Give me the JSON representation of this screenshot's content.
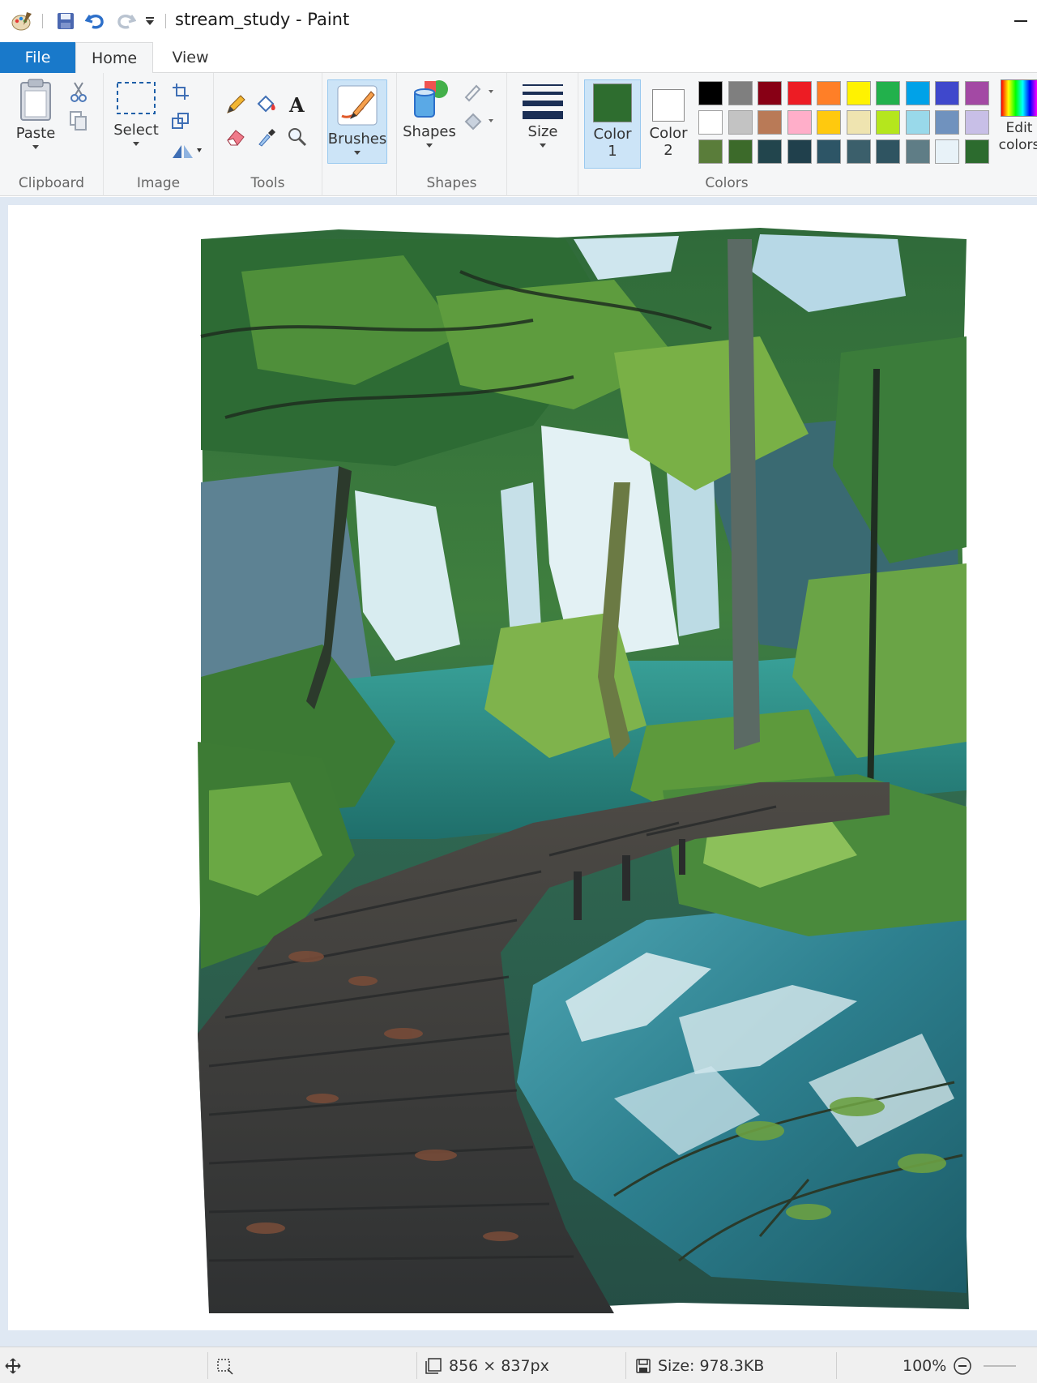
{
  "window": {
    "title": "stream_study - Paint"
  },
  "tabs": [
    {
      "label": "File"
    },
    {
      "label": "Home"
    },
    {
      "label": "View"
    }
  ],
  "ribbon": {
    "clipboard": {
      "group_label": "Clipboard",
      "paste_label": "Paste"
    },
    "image": {
      "group_label": "Image",
      "select_label": "Select"
    },
    "tools": {
      "group_label": "Tools"
    },
    "brushes": {
      "label": "Brushes"
    },
    "shapes": {
      "group_label": "Shapes",
      "shapes_label": "Shapes"
    },
    "size": {
      "label": "Size"
    },
    "colors": {
      "group_label": "Colors",
      "color1_line1": "Color",
      "color1_line2": "1",
      "color2_line1": "Color",
      "color2_line2": "2",
      "edit_line1": "Edit",
      "edit_line2": "colors",
      "color1_value": "#2e6d2f",
      "color2_value": "#ffffff",
      "palette": [
        "#000000",
        "#7f7f7f",
        "#880015",
        "#ed1c24",
        "#ff7f27",
        "#fff200",
        "#22b14c",
        "#00a2e8",
        "#3f48cc",
        "#a349a4",
        "#ffffff",
        "#c3c3c3",
        "#b97a57",
        "#ffaec9",
        "#ffc90e",
        "#efe4b0",
        "#b5e61d",
        "#99d9ea",
        "#7092be",
        "#c8bfe7",
        "#5a7d3a",
        "#3c6a2a",
        "#22454d",
        "#20404c",
        "#2d5566",
        "#3b5f6b",
        "#2f5461",
        "#5f7d86",
        "#e8f2f8",
        "#2c6b2e"
      ]
    }
  },
  "statusbar": {
    "dimensions": "856 × 837px",
    "size": "Size: 978.3KB",
    "zoom": "100%"
  },
  "accent": "#1979ca"
}
